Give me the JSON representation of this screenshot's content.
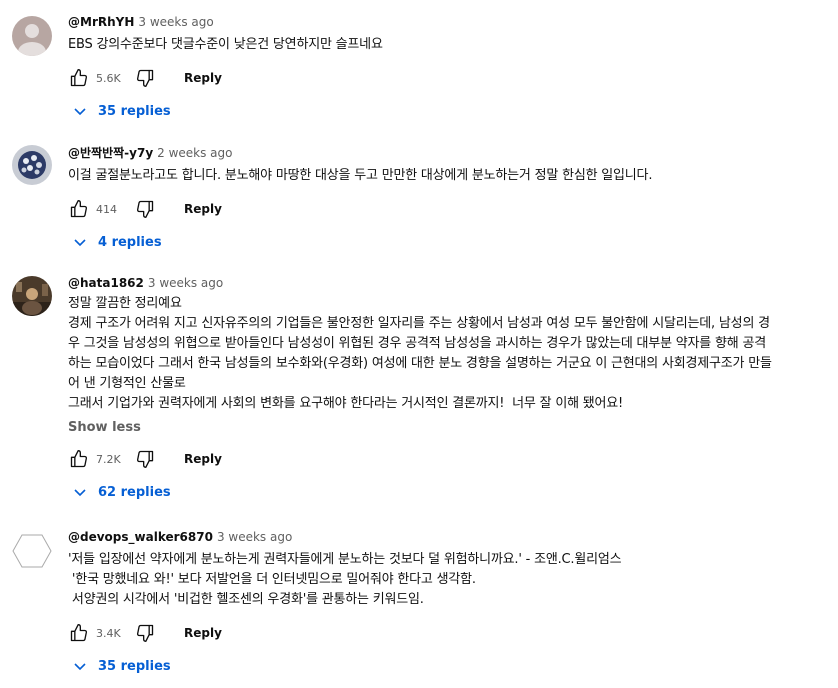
{
  "comments": [
    {
      "author": "@MrRhYH",
      "time": "3 weeks ago",
      "lines": [
        "EBS 강의수준보다 댓글수준이 낮은건 당연하지만 슬프네요"
      ],
      "likes": "5.6K",
      "reply_label": "Reply",
      "replies_label": "35 replies"
    },
    {
      "author": "@반짝반짝-y7y",
      "time": "2 weeks ago",
      "lines": [
        "이걸 굴절분노라고도 합니다. 분노해야 마땅한 대상을 두고 만만한 대상에게 분노하는거 정말 한심한 일입니다."
      ],
      "likes": "414",
      "reply_label": "Reply",
      "replies_label": "4 replies"
    },
    {
      "author": "@hata1862",
      "time": "3 weeks ago",
      "lines": [
        "정말 깔끔한 정리예요",
        "경제 구조가 어려워 지고 신자유주의의 기업들은 불안정한 일자리를 주는 상황에서 남성과 여성 모두 불안함에 시달리는데, 남성의 경",
        "우 그것을 남성성의 위협으로 받아들인다 남성성이 위협된 경우 공격적 남성성을 과시하는 경우가 많았는데 대부분 약자를 향해 공격",
        "하는 모습이었다 그래서 한국 남성들의 보수화와(우경화) 여성에 대한 분노 경향을 설명하는 거군요 이 근현대의 사회경제구조가 만들",
        "어 낸 기형적인 산물로",
        "그래서 기업가와 권력자에게 사회의 변화를 요구해야 한다라는 거시적인 결론까지!  너무 잘 이해 됐어요!"
      ],
      "show_less": "Show less",
      "likes": "7.2K",
      "reply_label": "Reply",
      "replies_label": "62 replies"
    },
    {
      "author": "@devops_walker6870",
      "time": "3 weeks ago",
      "lines": [
        "'저들 입장에선 약자에게 분노하는게 권력자들에게 분노하는 것보다 덜 위험하니까요.' - 조앤.C.윌리엄스",
        " '한국 망했네요 와!' 보다 저발언을 더 인터넷밈으로 밀어줘야 한다고 생각함.",
        " 서양권의 시각에서 '비겁한 헬조센의 우경화'를 관통하는 키워드임."
      ],
      "likes": "3.4K",
      "reply_label": "Reply",
      "replies_label": "35 replies"
    }
  ],
  "colors": {
    "link_blue": "#065fd4",
    "meta_gray": "#606060",
    "text": "#0f0f0f"
  },
  "icons": [
    "like-icon",
    "dislike-icon",
    "chevron-down-icon"
  ]
}
